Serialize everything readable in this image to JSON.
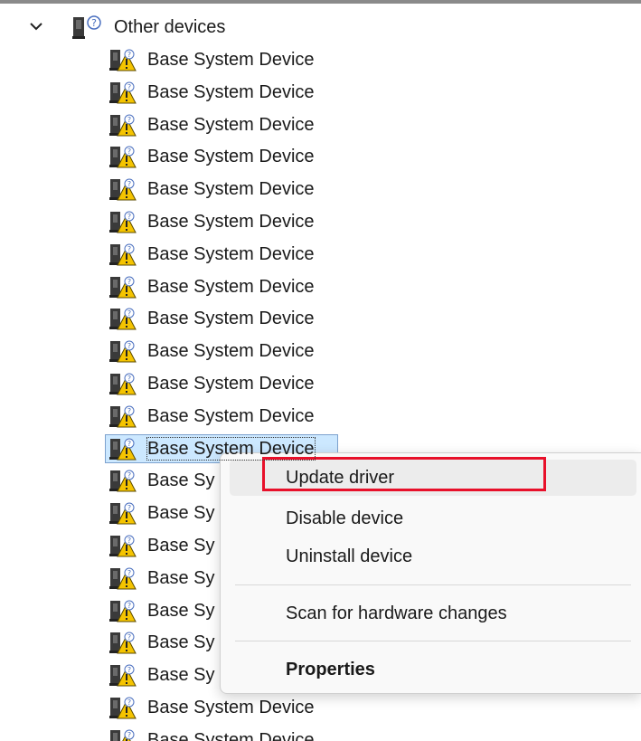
{
  "tree": {
    "category": {
      "label": "Other devices",
      "icon": "unknown-device-category-icon",
      "expanded": true
    },
    "device_icon": "device-warning-icon",
    "devices": [
      {
        "label": "Base System Device"
      },
      {
        "label": "Base System Device"
      },
      {
        "label": "Base System Device"
      },
      {
        "label": "Base System Device"
      },
      {
        "label": "Base System Device"
      },
      {
        "label": "Base System Device"
      },
      {
        "label": "Base System Device"
      },
      {
        "label": "Base System Device"
      },
      {
        "label": "Base System Device"
      },
      {
        "label": "Base System Device"
      },
      {
        "label": "Base System Device"
      },
      {
        "label": "Base System Device"
      },
      {
        "label": "Base System Device",
        "selected": true
      },
      {
        "label": "Base Sy"
      },
      {
        "label": "Base Sy"
      },
      {
        "label": "Base Sy"
      },
      {
        "label": "Base Sy"
      },
      {
        "label": "Base Sy"
      },
      {
        "label": "Base Sy"
      },
      {
        "label": "Base Sy"
      },
      {
        "label": "Base System Device"
      },
      {
        "label": "Base System Device"
      }
    ]
  },
  "context_menu": {
    "update_driver": "Update driver",
    "disable_device": "Disable device",
    "uninstall_device": "Uninstall device",
    "scan_hardware": "Scan for hardware changes",
    "properties": "Properties"
  },
  "colors": {
    "highlight_box": "#e8102a",
    "selection_bg": "#cce8ff",
    "warning_yellow": "#f5c400"
  }
}
